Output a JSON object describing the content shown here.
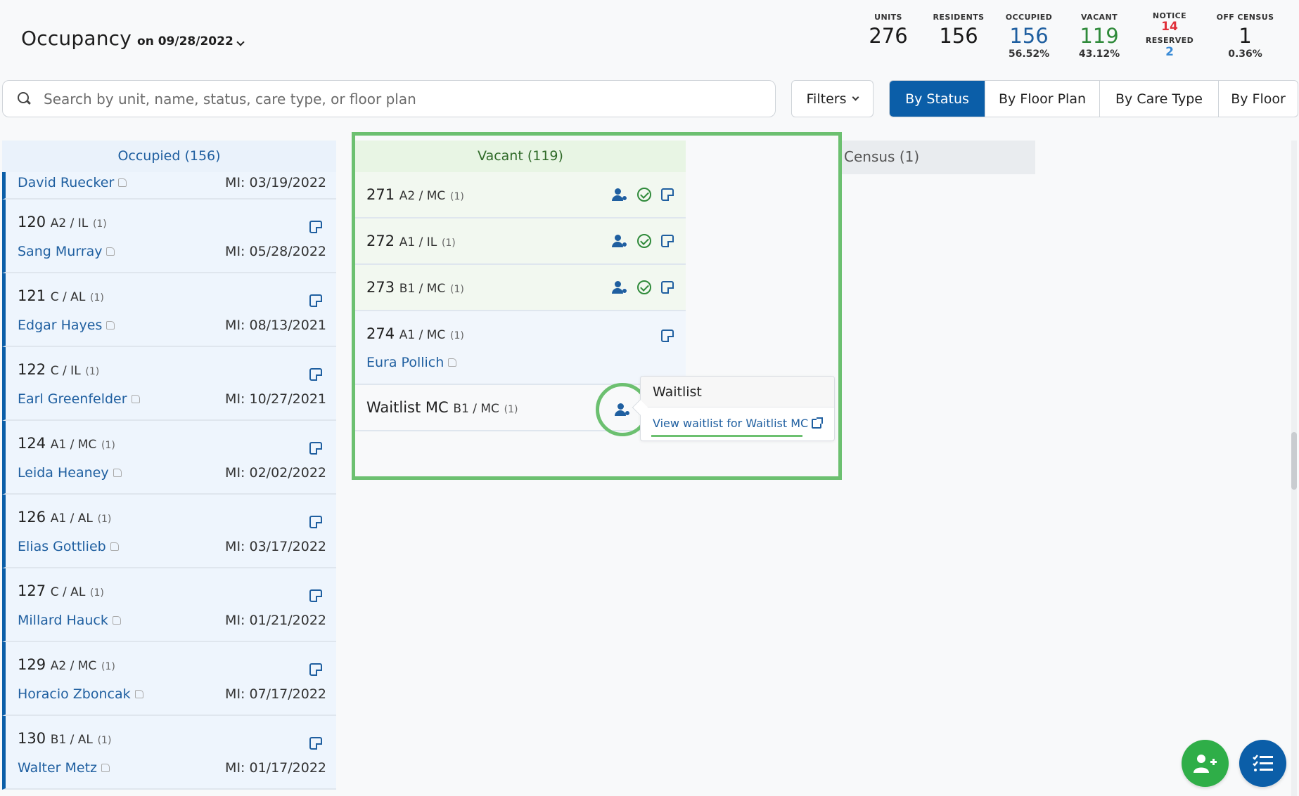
{
  "header": {
    "title": "Occupancy",
    "date_label": "on 09/28/2022"
  },
  "stats": {
    "units": {
      "label": "UNITS",
      "value": "276"
    },
    "residents": {
      "label": "RESIDENTS",
      "value": "156"
    },
    "occupied": {
      "label": "OCCUPIED",
      "value": "156",
      "pct": "56.52%"
    },
    "vacant": {
      "label": "VACANT",
      "value": "119",
      "pct": "43.12%"
    },
    "notice": {
      "label": "NOTICE",
      "value": "14"
    },
    "reserved": {
      "label": "RESERVED",
      "value": "2"
    },
    "off_census": {
      "label": "OFF CENSUS",
      "value": "1",
      "pct": "0.36%"
    }
  },
  "search": {
    "placeholder": "Search by unit, name, status, care type, or floor plan"
  },
  "filters_label": "Filters",
  "tabs": [
    {
      "label": "By Status"
    },
    {
      "label": "By Floor Plan"
    },
    {
      "label": "By Care Type"
    },
    {
      "label": "By Floor"
    }
  ],
  "occupied": {
    "header": "Occupied (156)",
    "partial_row": {
      "resident": "David Ruecker",
      "mi": "MI: 03/19/2022"
    },
    "rows": [
      {
        "unit": "120",
        "meta": "A2 / IL",
        "count": "(1)",
        "resident": "Sang Murray",
        "mi": "MI: 05/28/2022"
      },
      {
        "unit": "121",
        "meta": "C / AL",
        "count": "(1)",
        "resident": "Edgar Hayes",
        "mi": "MI: 08/13/2021"
      },
      {
        "unit": "122",
        "meta": "C / IL",
        "count": "(1)",
        "resident": "Earl Greenfelder",
        "mi": "MI: 10/27/2021"
      },
      {
        "unit": "124",
        "meta": "A1 / MC",
        "count": "(1)",
        "resident": "Leida Heaney",
        "mi": "MI: 02/02/2022"
      },
      {
        "unit": "126",
        "meta": "A1 / AL",
        "count": "(1)",
        "resident": "Elias Gottlieb",
        "mi": "MI: 03/17/2022"
      },
      {
        "unit": "127",
        "meta": "C / AL",
        "count": "(1)",
        "resident": "Millard Hauck",
        "mi": "MI: 01/21/2022"
      },
      {
        "unit": "129",
        "meta": "A2 / MC",
        "count": "(1)",
        "resident": "Horacio Zboncak",
        "mi": "MI: 07/17/2022"
      },
      {
        "unit": "130",
        "meta": "B1 / AL",
        "count": "(1)",
        "resident": "Walter Metz",
        "mi": "MI: 01/17/2022"
      }
    ]
  },
  "vacant": {
    "header": "Vacant (119)",
    "rows": [
      {
        "unit": "271",
        "meta": "A2 / MC",
        "count": "(1)"
      },
      {
        "unit": "272",
        "meta": "A1 / IL",
        "count": "(1)"
      },
      {
        "unit": "273",
        "meta": "B1 / MC",
        "count": "(1)"
      },
      {
        "unit": "274",
        "meta": "A1 / MC",
        "count": "(1)",
        "resident": "Eura Pollich"
      },
      {
        "unit": "Waitlist MC",
        "meta": "B1 / MC",
        "count": "(1)"
      }
    ]
  },
  "popover": {
    "title": "Waitlist",
    "link": "View waitlist for Waitlist MC"
  },
  "off_census": {
    "header": "Census (1)"
  },
  "colors": {
    "primary": "#0b5ea8",
    "green": "#2fae48",
    "highlight": "#6cc070",
    "notice": "#e0303a",
    "reserved": "#3a8bd6"
  }
}
